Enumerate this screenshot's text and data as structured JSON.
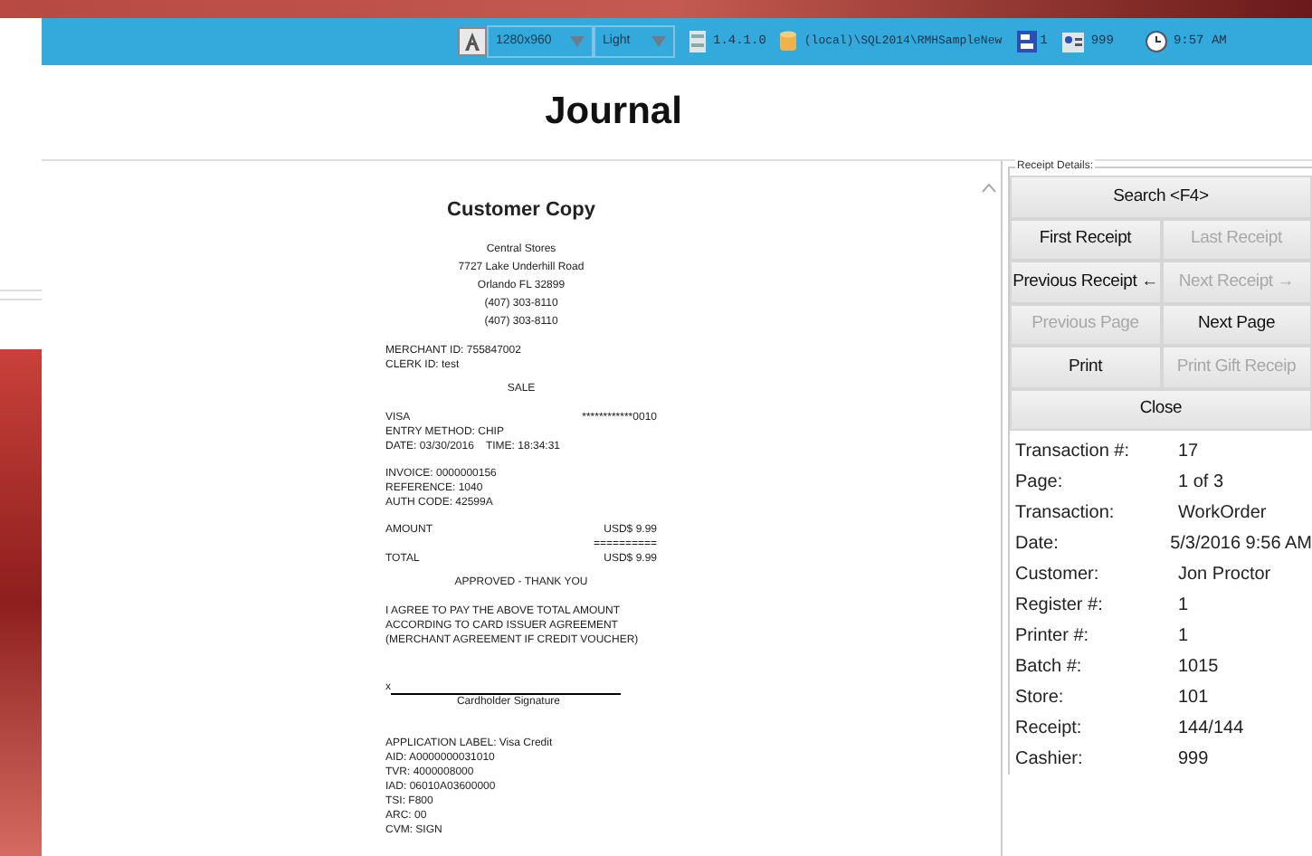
{
  "toolbar": {
    "resolution": "1280x960",
    "theme": "Light",
    "version": "1.4.1.0",
    "database": "(local)\\SQL2014\\RMHSampleNew",
    "register": "1",
    "cashier": "999",
    "time": "9:57 AM"
  },
  "title": "Journal",
  "receipt": {
    "blocks": [
      {
        "kind": "title",
        "lines": [
          "Customer Copy"
        ]
      },
      {
        "kind": "center",
        "lines": [
          "Central Stores",
          "7727 Lake Underhill Road",
          "Orlando FL 32899",
          "(407) 303-8110",
          "(407) 303-8110"
        ]
      },
      {
        "kind": "rows",
        "lines": [
          {
            "left": "MERCHANT ID: 755847002"
          },
          {
            "left": "CLERK ID: test"
          }
        ]
      },
      {
        "kind": "center",
        "lines": [
          "SALE"
        ]
      },
      {
        "kind": "rows",
        "lines": [
          {
            "left": "VISA",
            "right": "************0010"
          },
          {
            "left": "ENTRY METHOD: CHIP"
          },
          {
            "left": "DATE: 03/30/2016    TIME: 18:34:31"
          }
        ]
      },
      {
        "kind": "rows",
        "lines": [
          {
            "left": "INVOICE: 0000000156"
          },
          {
            "left": "REFERENCE: 1040"
          },
          {
            "left": "AUTH CODE: 42599A"
          }
        ]
      },
      {
        "kind": "rows",
        "lines": [
          {
            "left": "AMOUNT",
            "right": "USD$ 9.99"
          },
          {
            "right": "=========="
          },
          {
            "left": "TOTAL",
            "right": "USD$ 9.99"
          }
        ]
      },
      {
        "kind": "center",
        "lines": [
          "APPROVED - THANK YOU"
        ]
      },
      {
        "kind": "rows",
        "lines": [
          {
            "left": "I AGREE TO PAY THE ABOVE TOTAL AMOUNT"
          },
          {
            "left": "ACCORDING TO CARD ISSUER AGREEMENT"
          },
          {
            "left": "(MERCHANT AGREEMENT IF CREDIT VOUCHER)"
          }
        ]
      },
      {
        "kind": "signature",
        "lines": [
          "x",
          "Cardholder Signature"
        ]
      },
      {
        "kind": "rows",
        "lines": [
          {
            "left": "APPLICATION LABEL: Visa Credit"
          },
          {
            "left": "AID: A0000000031010"
          },
          {
            "left": "TVR: 4000008000"
          },
          {
            "left": "IAD: 06010A03600000"
          },
          {
            "left": "TSI: F800"
          },
          {
            "left": "ARC: 00"
          },
          {
            "left": "CVM: SIGN"
          }
        ]
      }
    ]
  },
  "details": {
    "label": "Receipt Details:",
    "buttons": [
      [
        {
          "label": "Search <F4>",
          "disabled": false
        }
      ],
      [
        {
          "label": "First Receipt",
          "disabled": false
        },
        {
          "label": "Last Receipt",
          "disabled": true
        }
      ],
      [
        {
          "label": "Previous Receipt ←",
          "disabled": false
        },
        {
          "label": "Next Receipt →",
          "disabled": true
        }
      ],
      [
        {
          "label": "Previous Page",
          "disabled": true
        },
        {
          "label": "Next Page",
          "disabled": false
        }
      ],
      [
        {
          "label": "Print",
          "disabled": false
        },
        {
          "label": "Print Gift Receip",
          "disabled": true
        }
      ],
      [
        {
          "label": "Close",
          "disabled": false
        }
      ]
    ],
    "fields": [
      {
        "label": "Transaction #:",
        "value": "17"
      },
      {
        "label": "Page:",
        "value": "1 of 3"
      },
      {
        "label": "Transaction:",
        "value": "WorkOrder"
      },
      {
        "label": "Date:",
        "value": "5/3/2016 9:56 AM"
      },
      {
        "label": "Customer:",
        "value": "Jon Proctor"
      },
      {
        "label": "Register #:",
        "value": "1"
      },
      {
        "label": "Printer #:",
        "value": "1"
      },
      {
        "label": "Batch #:",
        "value": "1015"
      },
      {
        "label": "Store:",
        "value": "101"
      },
      {
        "label": "Receipt:",
        "value": "144/144"
      },
      {
        "label": "Cashier:",
        "value": "999"
      }
    ]
  }
}
